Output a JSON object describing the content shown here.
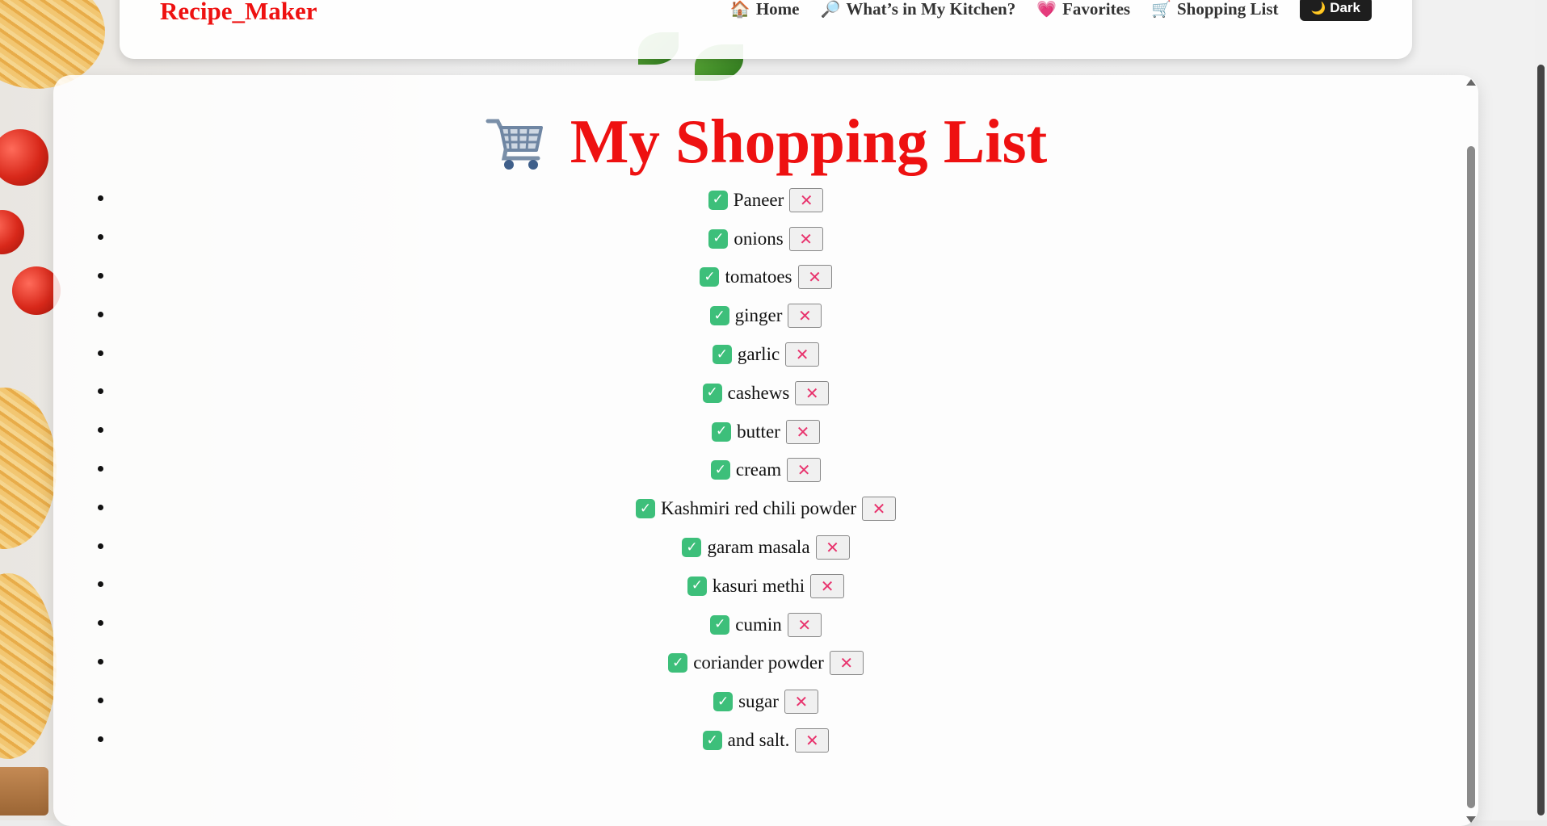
{
  "navbar": {
    "brand": "Recipe_Maker",
    "links": [
      {
        "icon": "🏠",
        "label": "Home"
      },
      {
        "icon": "🔎",
        "label": "What’s in My Kitchen?"
      },
      {
        "icon": "💗",
        "label": "Favorites"
      },
      {
        "icon": "🛒",
        "label": "Shopping List"
      }
    ],
    "theme_toggle": {
      "icon": "🌙",
      "label": "Dark"
    }
  },
  "page": {
    "title": "My Shopping List",
    "title_icon": "shopping-cart-icon"
  },
  "shopping_list": {
    "check_glyph": "✓",
    "remove_glyph": "✕",
    "items": [
      "Paneer",
      "onions",
      "tomatoes",
      "ginger",
      "garlic",
      "cashews",
      "butter",
      "cream",
      "Kashmiri red chili powder",
      "garam masala",
      "kasuri methi",
      "cumin",
      "coriander powder",
      "sugar",
      "and salt."
    ]
  },
  "colors": {
    "brand": "#ee1111",
    "check": "#3dbf7a",
    "remove": "#e8336d",
    "dark_button": "#1e1e1e"
  }
}
